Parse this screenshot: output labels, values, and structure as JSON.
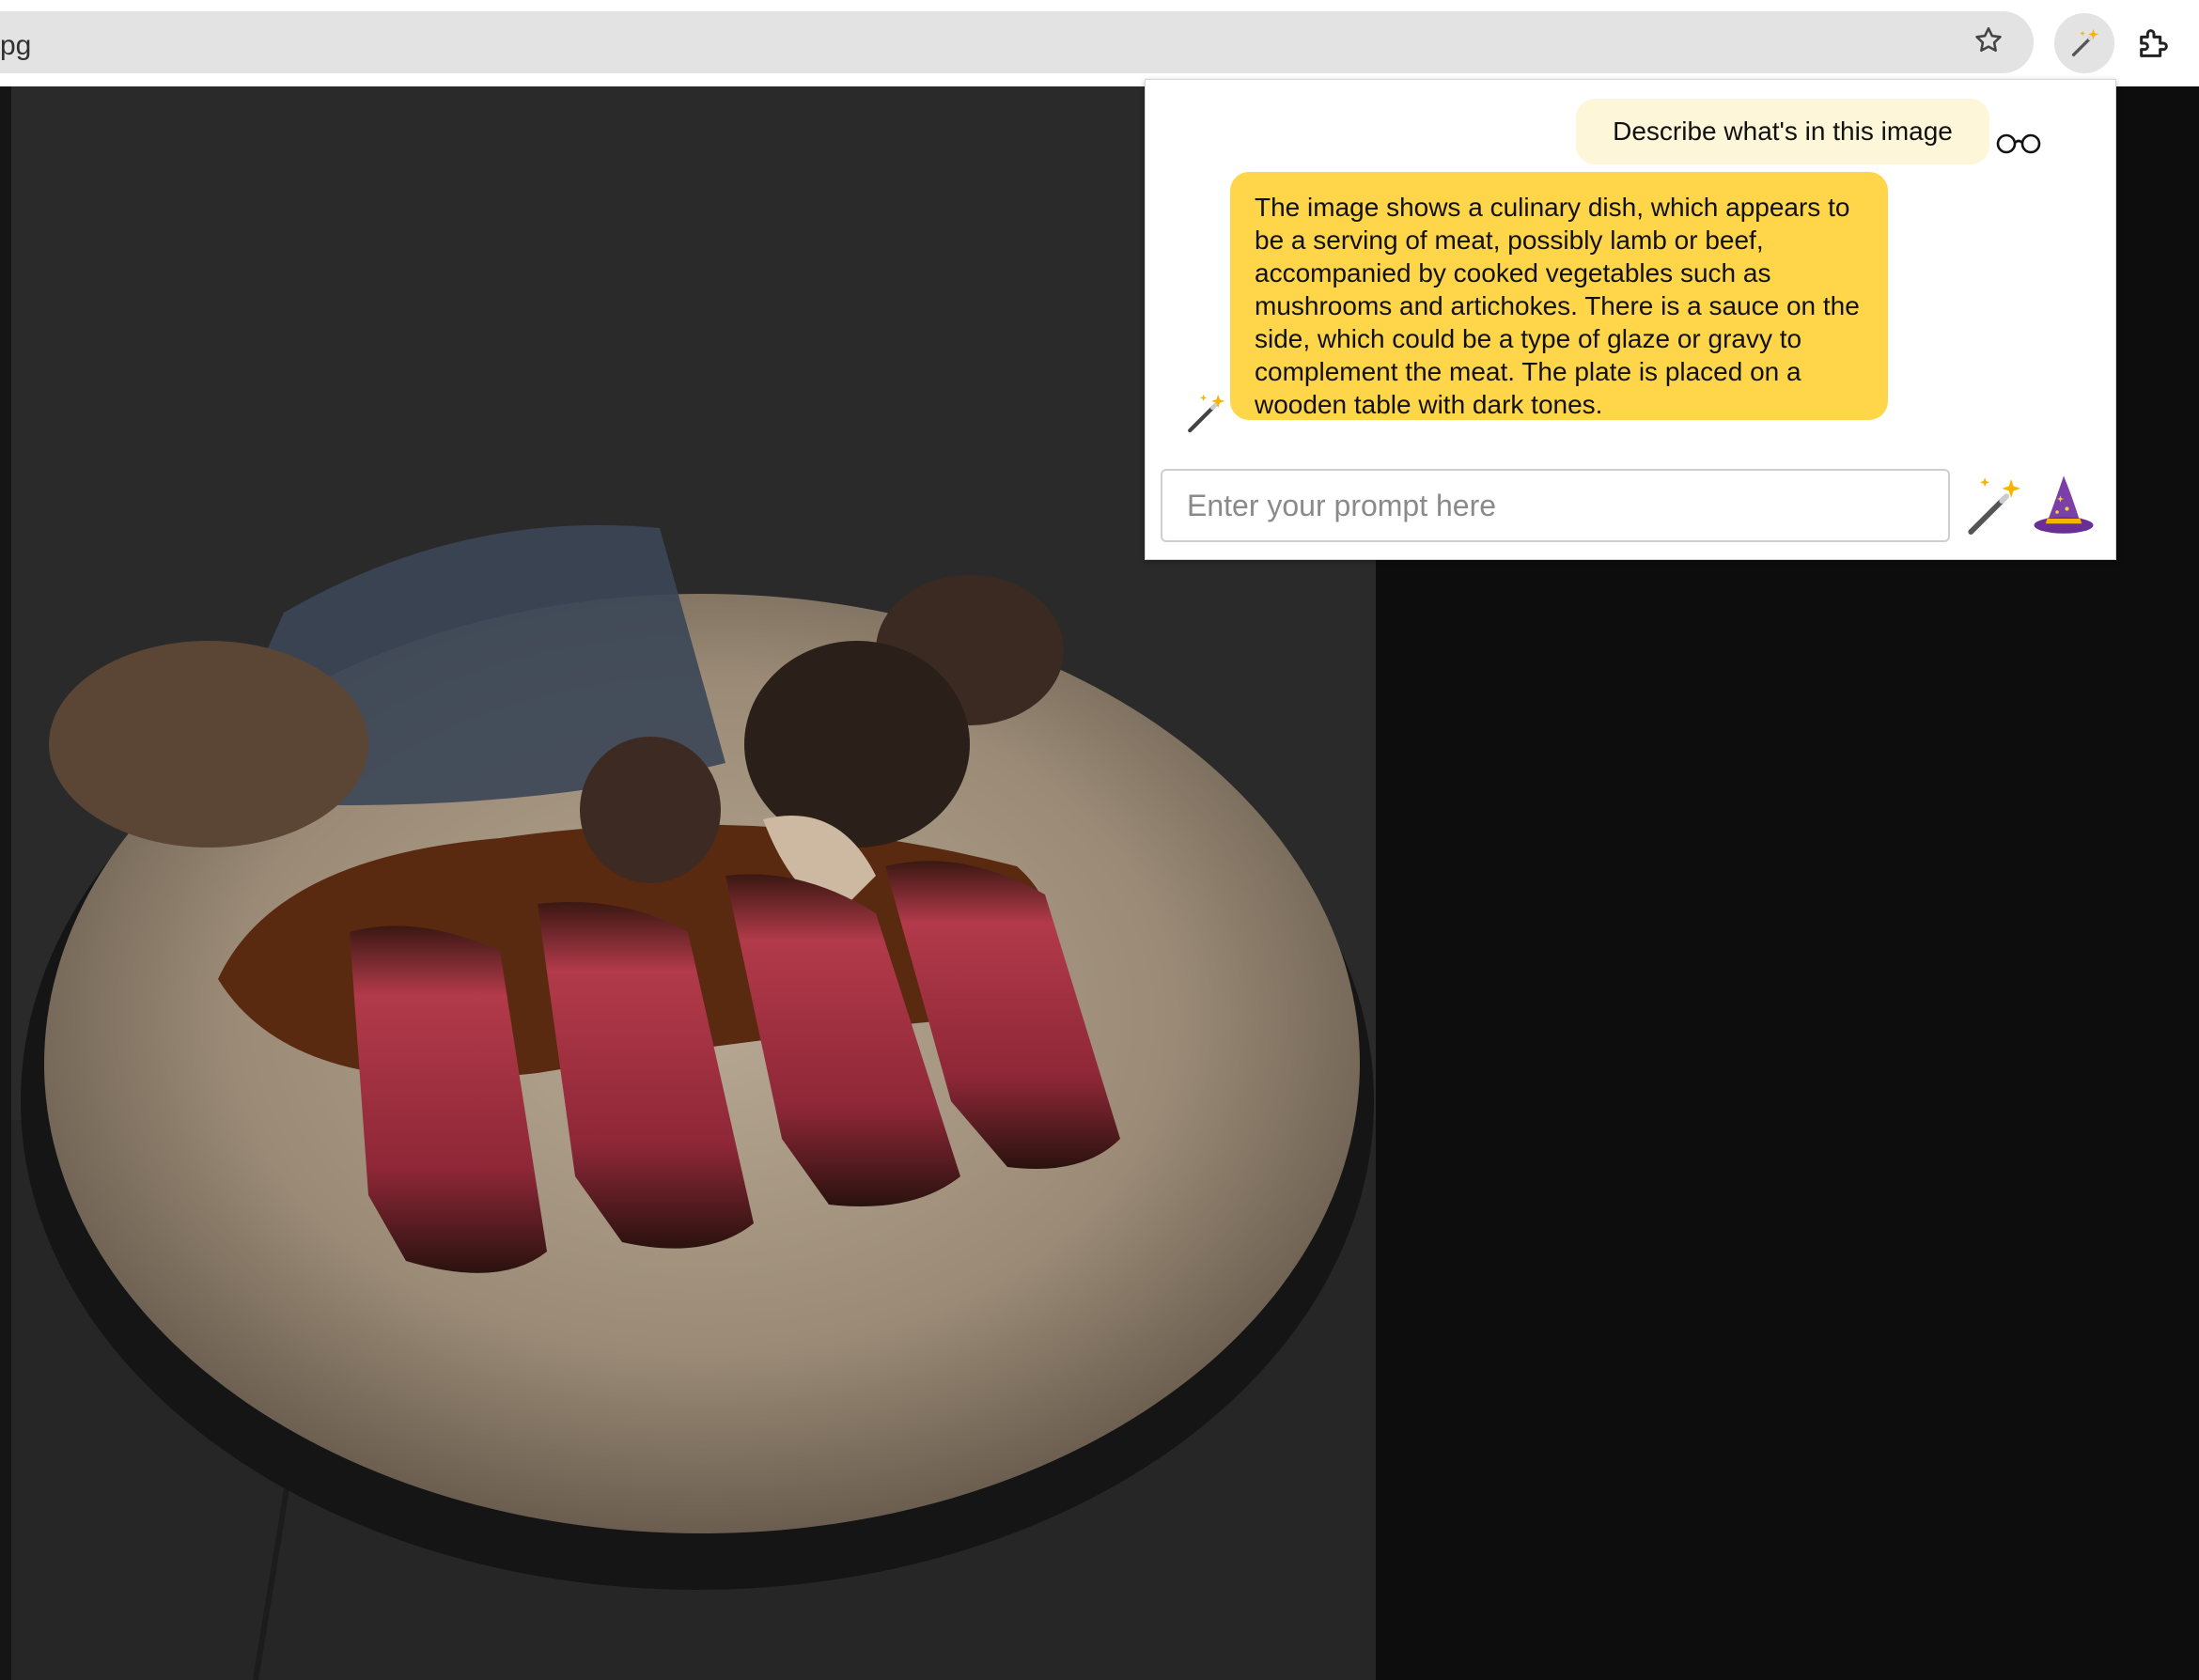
{
  "browser": {
    "address_text": "pg",
    "icons": [
      "star-icon",
      "magic-wand-extension-icon",
      "puzzle-icon"
    ]
  },
  "page": {
    "image_subject": "plated sliced steak with mushrooms and sauce on a round ceramic plate"
  },
  "popup": {
    "messages": [
      {
        "role": "user",
        "text": "Describe what's in this image",
        "icon": "glasses-icon"
      },
      {
        "role": "assistant",
        "icon": "magic-wand-icon",
        "text": " The image shows a culinary dish, which appears to be a serving of meat, possibly lamb or beef, accompanied by cooked vegetables such as mushrooms and artichokes. There is a sauce on the side, which could be a type of glaze or gravy to complement the meat. The plate is placed on a wooden table with dark tones."
      }
    ],
    "input": {
      "value": "",
      "placeholder": "Enter your prompt here"
    },
    "buttons": [
      "magic-wand-icon",
      "wizard-hat-icon"
    ]
  },
  "colors": {
    "user_bubble": "#fdf6d8",
    "assistant_bubble": "#ffd54a",
    "page_background": "#0d0d0d"
  }
}
